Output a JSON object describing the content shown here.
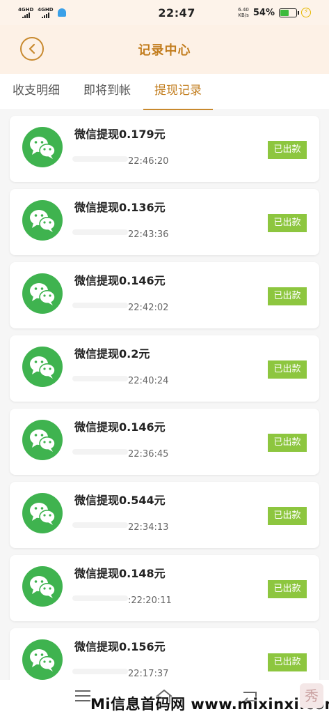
{
  "status_bar": {
    "network_1": "4GHD",
    "network_2": "4GHD",
    "time": "22:47",
    "net_speed_value": "6.40",
    "net_speed_unit": "KB/s",
    "battery_percent": "54%",
    "battery_level": 0.54
  },
  "header": {
    "title": "记录中心"
  },
  "tabs": [
    {
      "label": "收支明细",
      "active": false
    },
    {
      "label": "即将到帐",
      "active": false
    },
    {
      "label": "提现记录",
      "active": true
    }
  ],
  "records": [
    {
      "title": "微信提现0.179元",
      "time": "22:46:20",
      "status": "已出款"
    },
    {
      "title": "微信提现0.136元",
      "time": "22:43:36",
      "status": "已出款"
    },
    {
      "title": "微信提现0.146元",
      "time": "22:42:02",
      "status": "已出款"
    },
    {
      "title": "微信提现0.2元",
      "time": "22:40:24",
      "status": "已出款"
    },
    {
      "title": "微信提现0.146元",
      "time": "22:36:45",
      "status": "已出款"
    },
    {
      "title": "微信提现0.544元",
      "time": "22:34:13",
      "status": "已出款"
    },
    {
      "title": "微信提现0.148元",
      "time": ":22:20:11",
      "status": "已出款"
    },
    {
      "title": "微信提现0.156元",
      "time": "22:17:37",
      "status": "已出款"
    }
  ],
  "watermark": {
    "text": "Mi信息首码网 www.mixinxi.com",
    "logo_glyph": "秀"
  },
  "icons": {
    "back": "chevron-left-icon",
    "record": "wechat-icon",
    "nav_menu": "menu-icon",
    "nav_home": "home-icon",
    "nav_back": "return-icon"
  },
  "colors": {
    "accent": "#c27d1e",
    "header_bg": "#fdf1e6",
    "wechat_green": "#3fb34f",
    "status_tag": "#8dc63f"
  }
}
